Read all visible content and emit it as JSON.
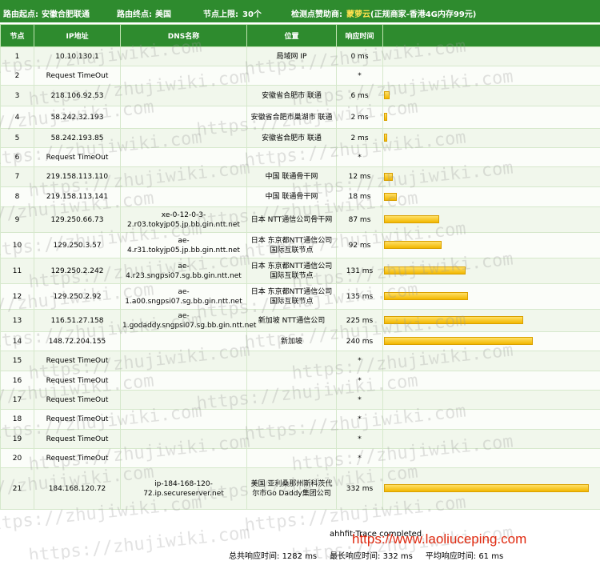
{
  "header": {
    "start_label": "路由起点:",
    "start_value": "安徽合肥联通",
    "end_label": "路由终点:",
    "end_value": "美国",
    "nodes_label": "节点上限:",
    "nodes_value": "30个",
    "sponsor_label": "检测点赞助商:",
    "sponsor_name": "蒙萝云",
    "sponsor_note": "(正规商家-香港4G内存99元)"
  },
  "columns": [
    "节点",
    "IP地址",
    "DNS名称",
    "位置",
    "响应时间",
    ""
  ],
  "rows": [
    {
      "n": "1",
      "ip": "10.10.130.1",
      "dns": "",
      "loc": "局域网 IP",
      "time": "0 ms",
      "ms": 0
    },
    {
      "n": "2",
      "ip": "Request TimeOut",
      "dns": "",
      "loc": "",
      "time": "*",
      "ms": 0
    },
    {
      "n": "3",
      "ip": "218.106.92.53",
      "dns": "",
      "loc": "安徽省合肥市 联通",
      "time": "6 ms",
      "ms": 6
    },
    {
      "n": "4",
      "ip": "58.242.32.193",
      "dns": "",
      "loc": "安徽省合肥市巢湖市 联通",
      "time": "2 ms",
      "ms": 2
    },
    {
      "n": "5",
      "ip": "58.242.193.85",
      "dns": "",
      "loc": "安徽省合肥市 联通",
      "time": "2 ms",
      "ms": 2
    },
    {
      "n": "6",
      "ip": "Request TimeOut",
      "dns": "",
      "loc": "",
      "time": "*",
      "ms": 0
    },
    {
      "n": "7",
      "ip": "219.158.113.110",
      "dns": "",
      "loc": "中国 联通骨干网",
      "time": "12 ms",
      "ms": 12
    },
    {
      "n": "8",
      "ip": "219.158.113.141",
      "dns": "",
      "loc": "中国 联通骨干网",
      "time": "18 ms",
      "ms": 18
    },
    {
      "n": "9",
      "ip": "129.250.66.73",
      "dns": "xe-0-12-0-3-2.r03.tokyjp05.jp.bb.gin.ntt.net",
      "loc": "日本 NTT通信公司骨干网",
      "time": "87 ms",
      "ms": 87
    },
    {
      "n": "10",
      "ip": "129.250.3.57",
      "dns": "ae-4.r31.tokyjp05.jp.bb.gin.ntt.net",
      "loc": "日本 东京都NTT通信公司国际互联节点",
      "time": "92 ms",
      "ms": 92
    },
    {
      "n": "11",
      "ip": "129.250.2.242",
      "dns": "ae-4.r23.sngpsi07.sg.bb.gin.ntt.net",
      "loc": "日本 东京都NTT通信公司国际互联节点",
      "time": "131 ms",
      "ms": 131
    },
    {
      "n": "12",
      "ip": "129.250.2.92",
      "dns": "ae-1.a00.sngpsi07.sg.bb.gin.ntt.net",
      "loc": "日本 东京都NTT通信公司国际互联节点",
      "time": "135 ms",
      "ms": 135
    },
    {
      "n": "13",
      "ip": "116.51.27.158",
      "dns": "ae-1.godaddy.sngpsi07.sg.bb.gin.ntt.net",
      "loc": "新加坡 NTT通信公司",
      "time": "225 ms",
      "ms": 225
    },
    {
      "n": "14",
      "ip": "148.72.204.155",
      "dns": "",
      "loc": "新加坡",
      "time": "240 ms",
      "ms": 240
    },
    {
      "n": "15",
      "ip": "Request TimeOut",
      "dns": "",
      "loc": "",
      "time": "*",
      "ms": 0
    },
    {
      "n": "16",
      "ip": "Request TimeOut",
      "dns": "",
      "loc": "",
      "time": "*",
      "ms": 0
    },
    {
      "n": "17",
      "ip": "Request TimeOut",
      "dns": "",
      "loc": "",
      "time": "*",
      "ms": 0
    },
    {
      "n": "18",
      "ip": "Request TimeOut",
      "dns": "",
      "loc": "",
      "time": "*",
      "ms": 0
    },
    {
      "n": "19",
      "ip": "Request TimeOut",
      "dns": "",
      "loc": "",
      "time": "*",
      "ms": 0
    },
    {
      "n": "20",
      "ip": "Request TimeOut",
      "dns": "",
      "loc": "",
      "time": "*",
      "ms": 0
    },
    {
      "n": "21",
      "ip": "184.168.120.72",
      "dns": "ip-184-168-120-72.ip.secureserver.net",
      "loc": "美国 亚利桑那州斯科茨代尔市Go Daddy集团公司",
      "time": "332 ms",
      "ms": 332
    }
  ],
  "status": "ahhfit:Trace completed",
  "summary": {
    "total_label": "总共响应时间:",
    "total_value": "1282 ms",
    "max_label": "最长响应时间:",
    "max_value": "332 ms",
    "avg_label": "平均响应时间:",
    "avg_value": "61 ms"
  },
  "watermark_text": "https://zhujiwiki.com",
  "site_watermark": "https://www.laoliuceping.com",
  "colors": {
    "header_green": "#2e8b2e",
    "bar_yellow": "#f2b800",
    "sponsor_yellow": "#ffe14d"
  }
}
